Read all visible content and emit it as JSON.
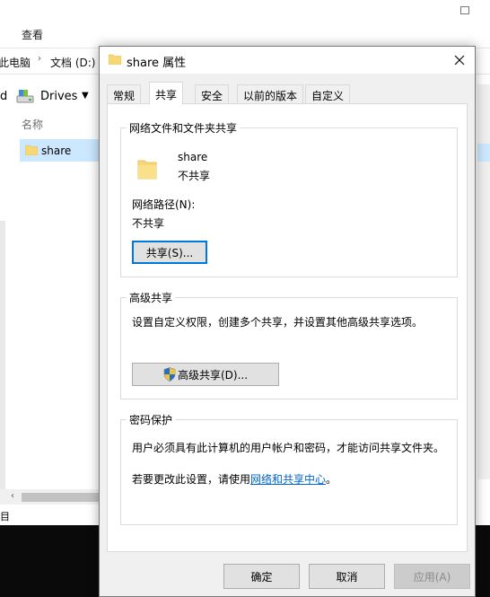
{
  "background_window": {
    "ribbon_tab": "查看",
    "breadcrumb": [
      "此电脑",
      "文档 (D:)"
    ],
    "nav_drive_letter": "d",
    "nav_drives_label": "Drives",
    "column_header": "名称",
    "selected_item": "share",
    "status_fragment": "目"
  },
  "dialog": {
    "title": "share 属性",
    "tabs": [
      {
        "label": "常规"
      },
      {
        "label": "共享",
        "active": true
      },
      {
        "label": "安全"
      },
      {
        "label": "以前的版本"
      },
      {
        "label": "自定义"
      }
    ],
    "network_sharing": {
      "group_title": "网络文件和文件夹共享",
      "folder_name": "share",
      "share_status": "不共享",
      "network_path_label": "网络路径(N):",
      "network_path_value": "不共享",
      "share_button": "共享(S)..."
    },
    "advanced_sharing": {
      "group_title": "高级共享",
      "description": "设置自定义权限，创建多个共享，并设置其他高级共享选项。",
      "button": "高级共享(D)..."
    },
    "password_protection": {
      "group_title": "密码保护",
      "line1": "用户必须具有此计算机的用户帐户和密码，才能访问共享文件夹。",
      "line2_prefix": "若要更改此设置，请使用",
      "line2_link": "网络和共享中心",
      "line2_suffix": "。"
    },
    "footer": {
      "ok": "确定",
      "cancel": "取消",
      "apply": "应用(A)"
    }
  },
  "colors": {
    "accent": "#0078d7",
    "selection": "#cce8ff",
    "link": "#0066cc",
    "folder": "#f8d775"
  }
}
